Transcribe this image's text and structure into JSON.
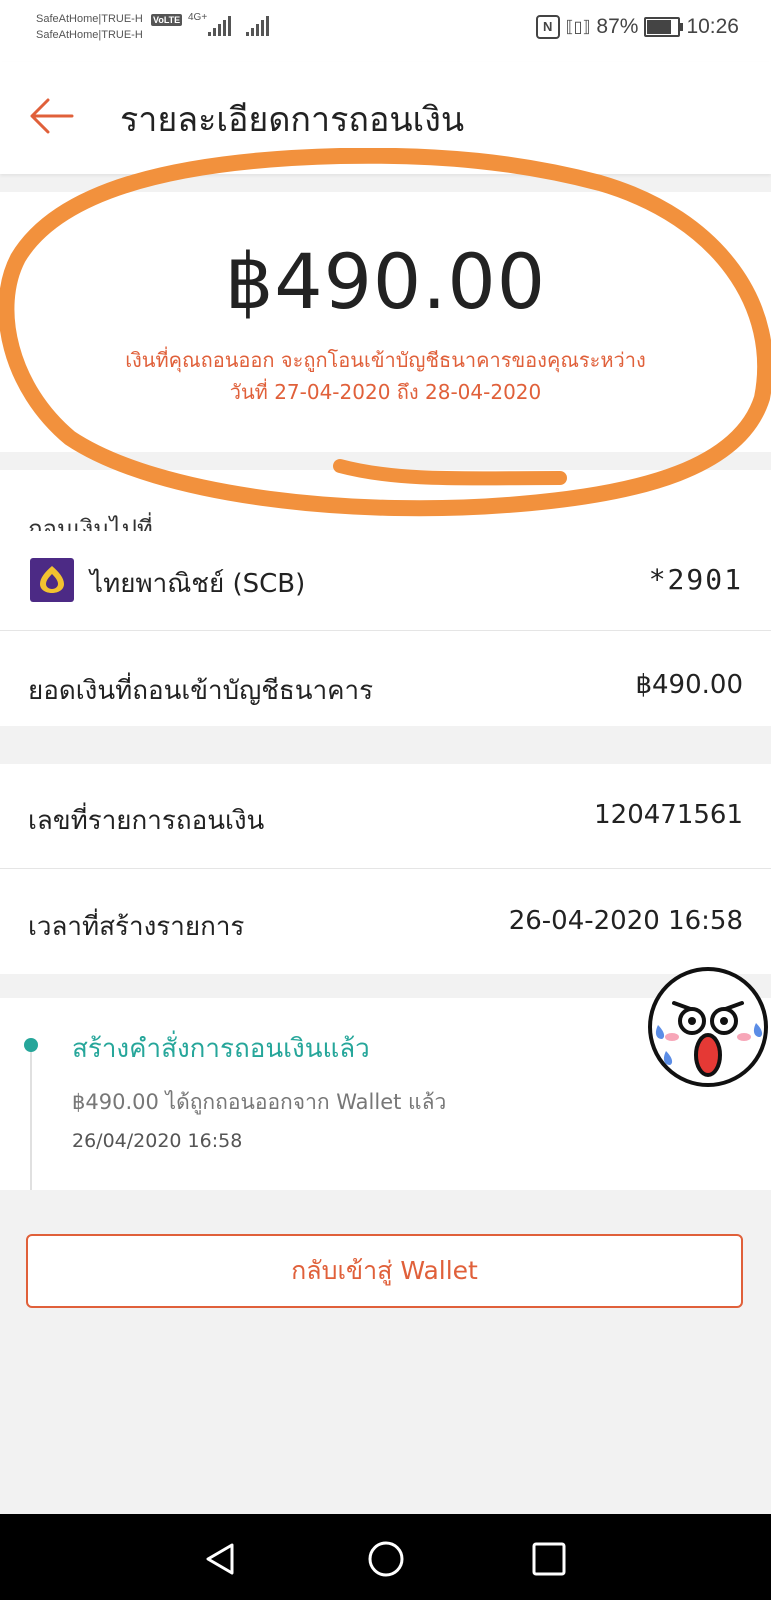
{
  "status_bar": {
    "carrier_1": "SafeAtHome|TRUE-H",
    "carrier_2": "SafeAtHome|TRUE-H",
    "volte": "VoLTE",
    "network": "4G+",
    "battery": "87%",
    "time": "10:26"
  },
  "header": {
    "title": "รายละเอียดการถอนเงิน"
  },
  "summary": {
    "amount": "฿490.00",
    "note_line1": "เงินที่คุณถอนออก จะถูกโอนเข้าบัญชีธนาคารของคุณระหว่าง",
    "note_line2": "วันที่ 27-04-2020 ถึง  28-04-2020"
  },
  "destination": {
    "label": "ถอนเงินไปที่",
    "bank_name": "ไทยพาณิชย์ (SCB)",
    "account": "*2901"
  },
  "details": {
    "amount_label": "ยอดเงินที่ถอนเข้าบัญชีธนาคาร",
    "amount_value": "฿490.00",
    "txn_label": "เลขที่รายการถอนเงิน",
    "txn_value": "120471561",
    "created_label": "เวลาที่สร้างรายการ",
    "created_value": "26-04-2020 16:58"
  },
  "timeline": {
    "title": "สร้างคำสั่งการถอนเงินแล้ว",
    "desc": "฿490.00 ได้ถูกถอนออกจาก Wallet แล้ว",
    "time": "26/04/2020 16:58"
  },
  "actions": {
    "back_to_wallet": "กลับเข้าสู่ Wallet"
  },
  "colors": {
    "accent": "#e0603a",
    "annotation": "#f2913d",
    "timeline": "#26a69a",
    "bank": "#4c2a85"
  }
}
